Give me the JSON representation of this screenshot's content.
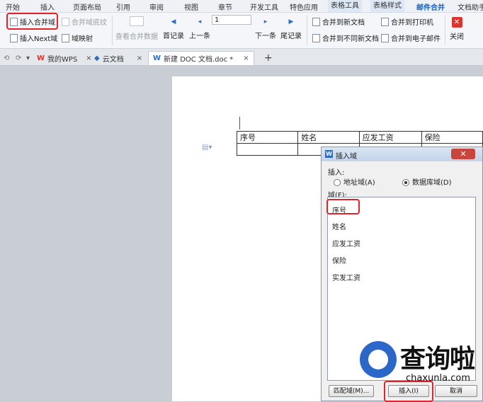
{
  "menu": [
    "开始",
    "插入",
    "页面布局",
    "引用",
    "审阅",
    "视图",
    "章节",
    "开发工具",
    "特色应用",
    "表格工具",
    "表格样式",
    "邮件合并",
    "文档助手"
  ],
  "ribbon": {
    "insert_field": "插入合并域",
    "merge_shading": "合并域底纹",
    "insert_next": "插入Next域",
    "field_map": "域映射",
    "view_merged": "查看合并数据",
    "first_record": "首记录",
    "prev": "上一条",
    "record_value": "1",
    "next": "下一条",
    "last_record": "尾记录",
    "merge_new_doc": "合并到新文档",
    "merge_diff_docs": "合并到不同新文档",
    "merge_printer": "合并到打印机",
    "merge_email": "合并到电子邮件",
    "close": "关闭"
  },
  "tabs": [
    {
      "label": "我的WPS"
    },
    {
      "label": "云文档"
    },
    {
      "label": "新建 DOC 文档.doc *"
    }
  ],
  "table": {
    "headers": [
      "序号",
      "姓名",
      "应发工资",
      "保险"
    ]
  },
  "dialog": {
    "title": "插入域",
    "close": "✕",
    "insert_label": "插入:",
    "opt_address": "地址域(A)",
    "opt_database": "数据库域(D)",
    "fields_label": "域(F):",
    "fields": [
      "序号",
      "姓名",
      "应发工资",
      "保险",
      "实发工资"
    ],
    "match_button": "匹配域(M)...",
    "insert_button": "插入(I)",
    "cancel_button": "取消"
  },
  "watermark": {
    "text": "查询啦",
    "url": "chaxunla.com"
  },
  "colors": {
    "highlight": "#e0242c",
    "accent": "#1a5fb4"
  }
}
